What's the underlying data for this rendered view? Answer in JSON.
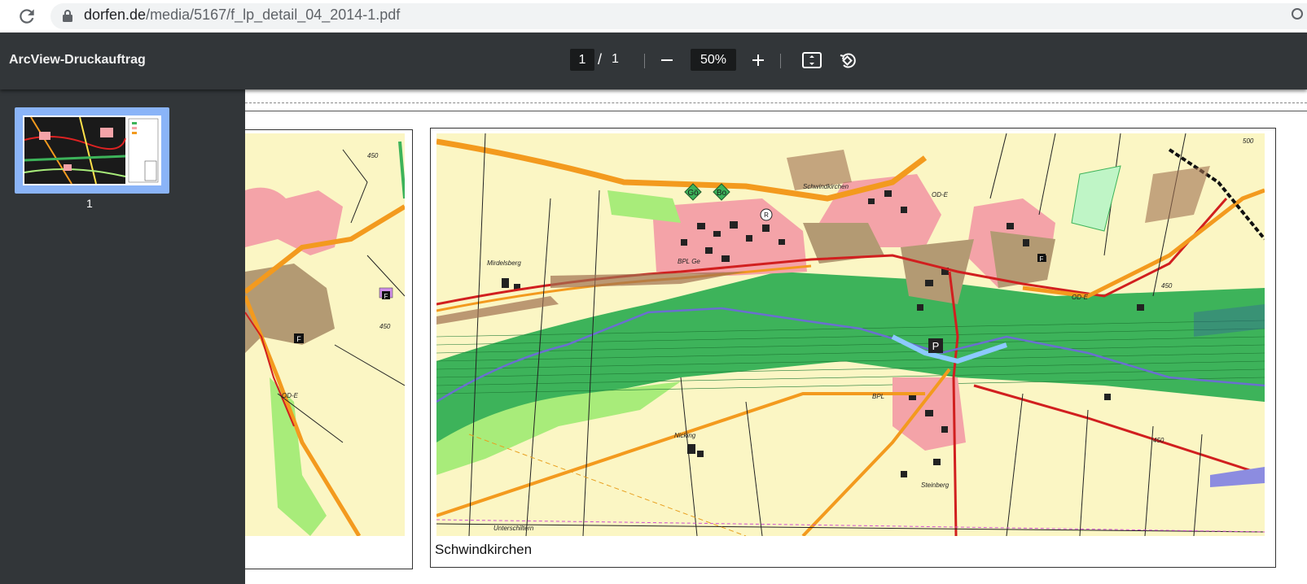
{
  "browser": {
    "url_host": "dorfen.de",
    "url_path": "/media/5167/f_lp_detail_04_2014-1.pdf"
  },
  "toolbar": {
    "title": "ArcView-Druckauftrag",
    "current_page": "1",
    "separator": "/",
    "total_pages": "1",
    "zoom": "50%"
  },
  "sidebar": {
    "thumbnails": [
      {
        "label": "1"
      }
    ]
  },
  "map": {
    "caption": "Schwindkirchen",
    "labels": {
      "mirdelsberg": "Mirdelsberg",
      "schwindkirchen": "Schwindkirchen",
      "nicking": "Nicking",
      "steinberg": "Steinberg",
      "unterschiltern": "Unterschiltern",
      "bpl": "BPL Ge",
      "od_e": "OD-E",
      "go": "Gö",
      "bo": "Bo",
      "p": "P",
      "r": "R",
      "f": "F",
      "contour_500": "500",
      "contour_450": "450",
      "contour_450b": "450",
      "left_450": "450",
      "left_450b": "450",
      "bpl_short": "BPL",
      "od_short": "OD-E",
      "left_od": "OD-E",
      "f_left": "F",
      "f_left2": "F"
    }
  },
  "colors": {
    "map_bg": "#fbf6c4",
    "settlement": "#f4a3a8",
    "settlement_brown": "#b39a73",
    "green_band": "#3db35a",
    "light_green": "#a8ec7a",
    "road": "#f39a1e",
    "red_road": "#d11f1f",
    "water": "#7aa7ff"
  }
}
